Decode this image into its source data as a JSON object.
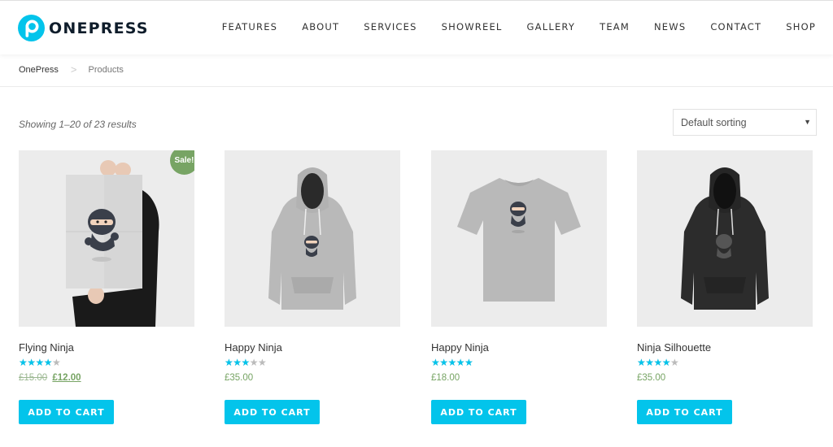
{
  "site": {
    "logo_text": "ONEPRESS",
    "brand_color": "#03c4eb",
    "logo_color": "#0f1d2b"
  },
  "nav": {
    "items": [
      "FEATURES",
      "ABOUT",
      "SERVICES",
      "SHOWREEL",
      "GALLERY",
      "TEAM",
      "NEWS",
      "CONTACT",
      "SHOP"
    ]
  },
  "breadcrumb": {
    "home": "OnePress",
    "separator": ">",
    "current": "Products"
  },
  "shop": {
    "result_count": "Showing 1–20 of 23 results",
    "sorting": {
      "selected": "Default sorting"
    },
    "star_glyphs": "★★★★★",
    "add_to_cart_label": "ADD TO CART",
    "sale_badge": "Sale!"
  },
  "products": [
    {
      "title": "Flying Ninja",
      "rating": 4,
      "regular_price": "£15.00",
      "sale_price": "£12.00",
      "on_sale": true,
      "image": "ninja-poster"
    },
    {
      "title": "Happy Ninja",
      "rating": 3,
      "price": "£35.00",
      "on_sale": false,
      "image": "grey-hoodie"
    },
    {
      "title": "Happy Ninja",
      "rating": 5,
      "price": "£18.00",
      "on_sale": false,
      "image": "grey-tshirt"
    },
    {
      "title": "Ninja Silhouette",
      "rating": 4,
      "price": "£35.00",
      "on_sale": false,
      "image": "black-hoodie"
    }
  ],
  "colors": {
    "sale_green": "#77a464",
    "star_blue": "#03c4eb",
    "image_bg": "#ececec"
  }
}
